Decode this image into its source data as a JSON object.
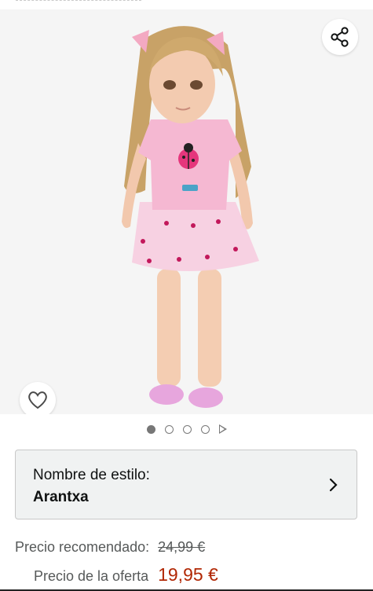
{
  "product": {
    "image_alt": "Muñeca con camiseta rosa y falda de tul",
    "carousel": {
      "pages": 4,
      "active_index": 0,
      "has_video": true
    }
  },
  "style_selector": {
    "label": "Nombre de estilo:",
    "value": "Arantxa"
  },
  "pricing": {
    "recommended_label": "Precio recomendado:",
    "recommended_price": "24,99 €",
    "offer_label": "Precio de la oferta",
    "offer_price": "19,95 €"
  },
  "icons": {
    "share": "share-icon",
    "wishlist": "heart-icon",
    "chevron": "chevron-right-icon",
    "video": "play-icon"
  },
  "colors": {
    "accent_price": "#b12704",
    "box_bg": "#f0f2f2",
    "hero_bg": "#f5f5f5"
  }
}
